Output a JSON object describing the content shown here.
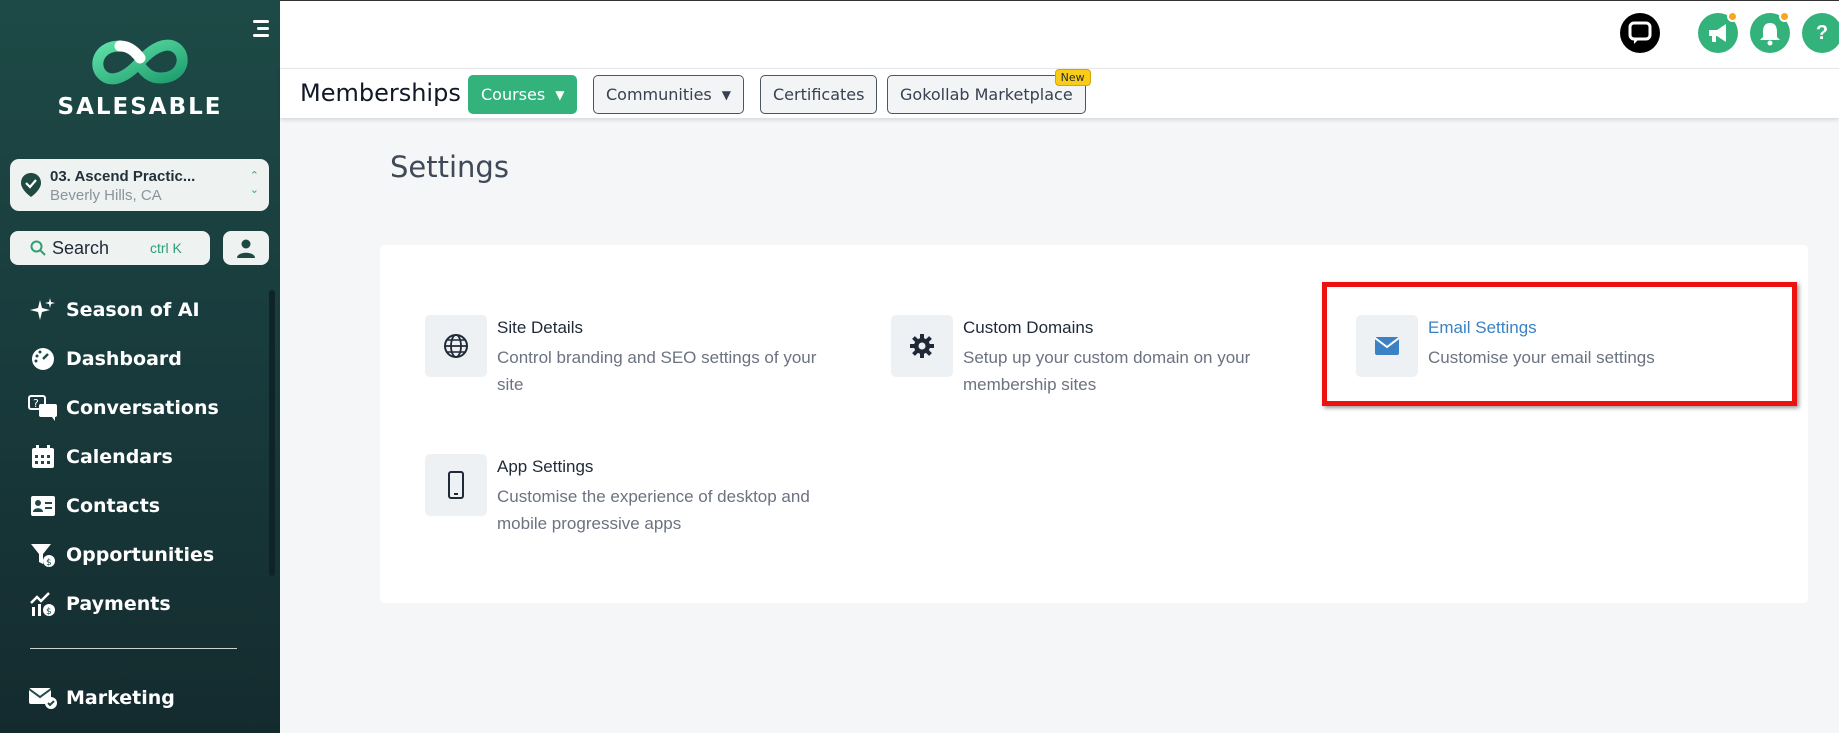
{
  "sidebar": {
    "logo_text": "SALESABLE",
    "location": {
      "name": "03. Ascend Practic...",
      "sub": "Beverly Hills, CA"
    },
    "search": {
      "label": "Search",
      "shortcut": "ctrl K"
    },
    "nav": [
      {
        "label": "Season of AI",
        "icon": "sparkles-icon"
      },
      {
        "label": "Dashboard",
        "icon": "gauge-icon"
      },
      {
        "label": "Conversations",
        "icon": "chat-bubbles-icon"
      },
      {
        "label": "Calendars",
        "icon": "calendar-icon"
      },
      {
        "label": "Contacts",
        "icon": "contact-card-icon"
      },
      {
        "label": "Opportunities",
        "icon": "funnel-icon"
      },
      {
        "label": "Payments",
        "icon": "payments-chart-icon"
      }
    ],
    "nav_bottom": [
      {
        "label": "Marketing",
        "icon": "mail-check-icon"
      }
    ]
  },
  "topbar": {
    "icons": [
      "chat-widget-icon",
      "megaphone-icon",
      "bell-icon",
      "help-icon"
    ],
    "help_glyph": "?"
  },
  "subnav": {
    "title": "Memberships",
    "tabs": [
      {
        "label": "Courses",
        "active": true,
        "dropdown": true
      },
      {
        "label": "Communities",
        "active": false,
        "dropdown": true
      },
      {
        "label": "Certificates",
        "active": false,
        "dropdown": false
      },
      {
        "label": "Gokollab Marketplace",
        "active": false,
        "dropdown": false,
        "badge": "New"
      }
    ]
  },
  "main": {
    "title": "Settings",
    "items": [
      {
        "title": "Site Details",
        "desc": "Control branding and SEO settings of your site",
        "icon": "globe-icon"
      },
      {
        "title": "Custom Domains",
        "desc": "Setup up your custom domain on your membership sites",
        "icon": "gear-icon"
      },
      {
        "title": "Email Settings",
        "desc": "Customise your email settings",
        "icon": "envelope-icon",
        "highlighted": true
      },
      {
        "title": "App Settings",
        "desc": "Customise the experience of desktop and mobile progressive apps",
        "icon": "mobile-phone-icon"
      }
    ]
  },
  "colors": {
    "accent": "#34b27b",
    "sidebar": "#1d4a46",
    "highlight": "#ee1111",
    "link": "#3b82c4"
  }
}
